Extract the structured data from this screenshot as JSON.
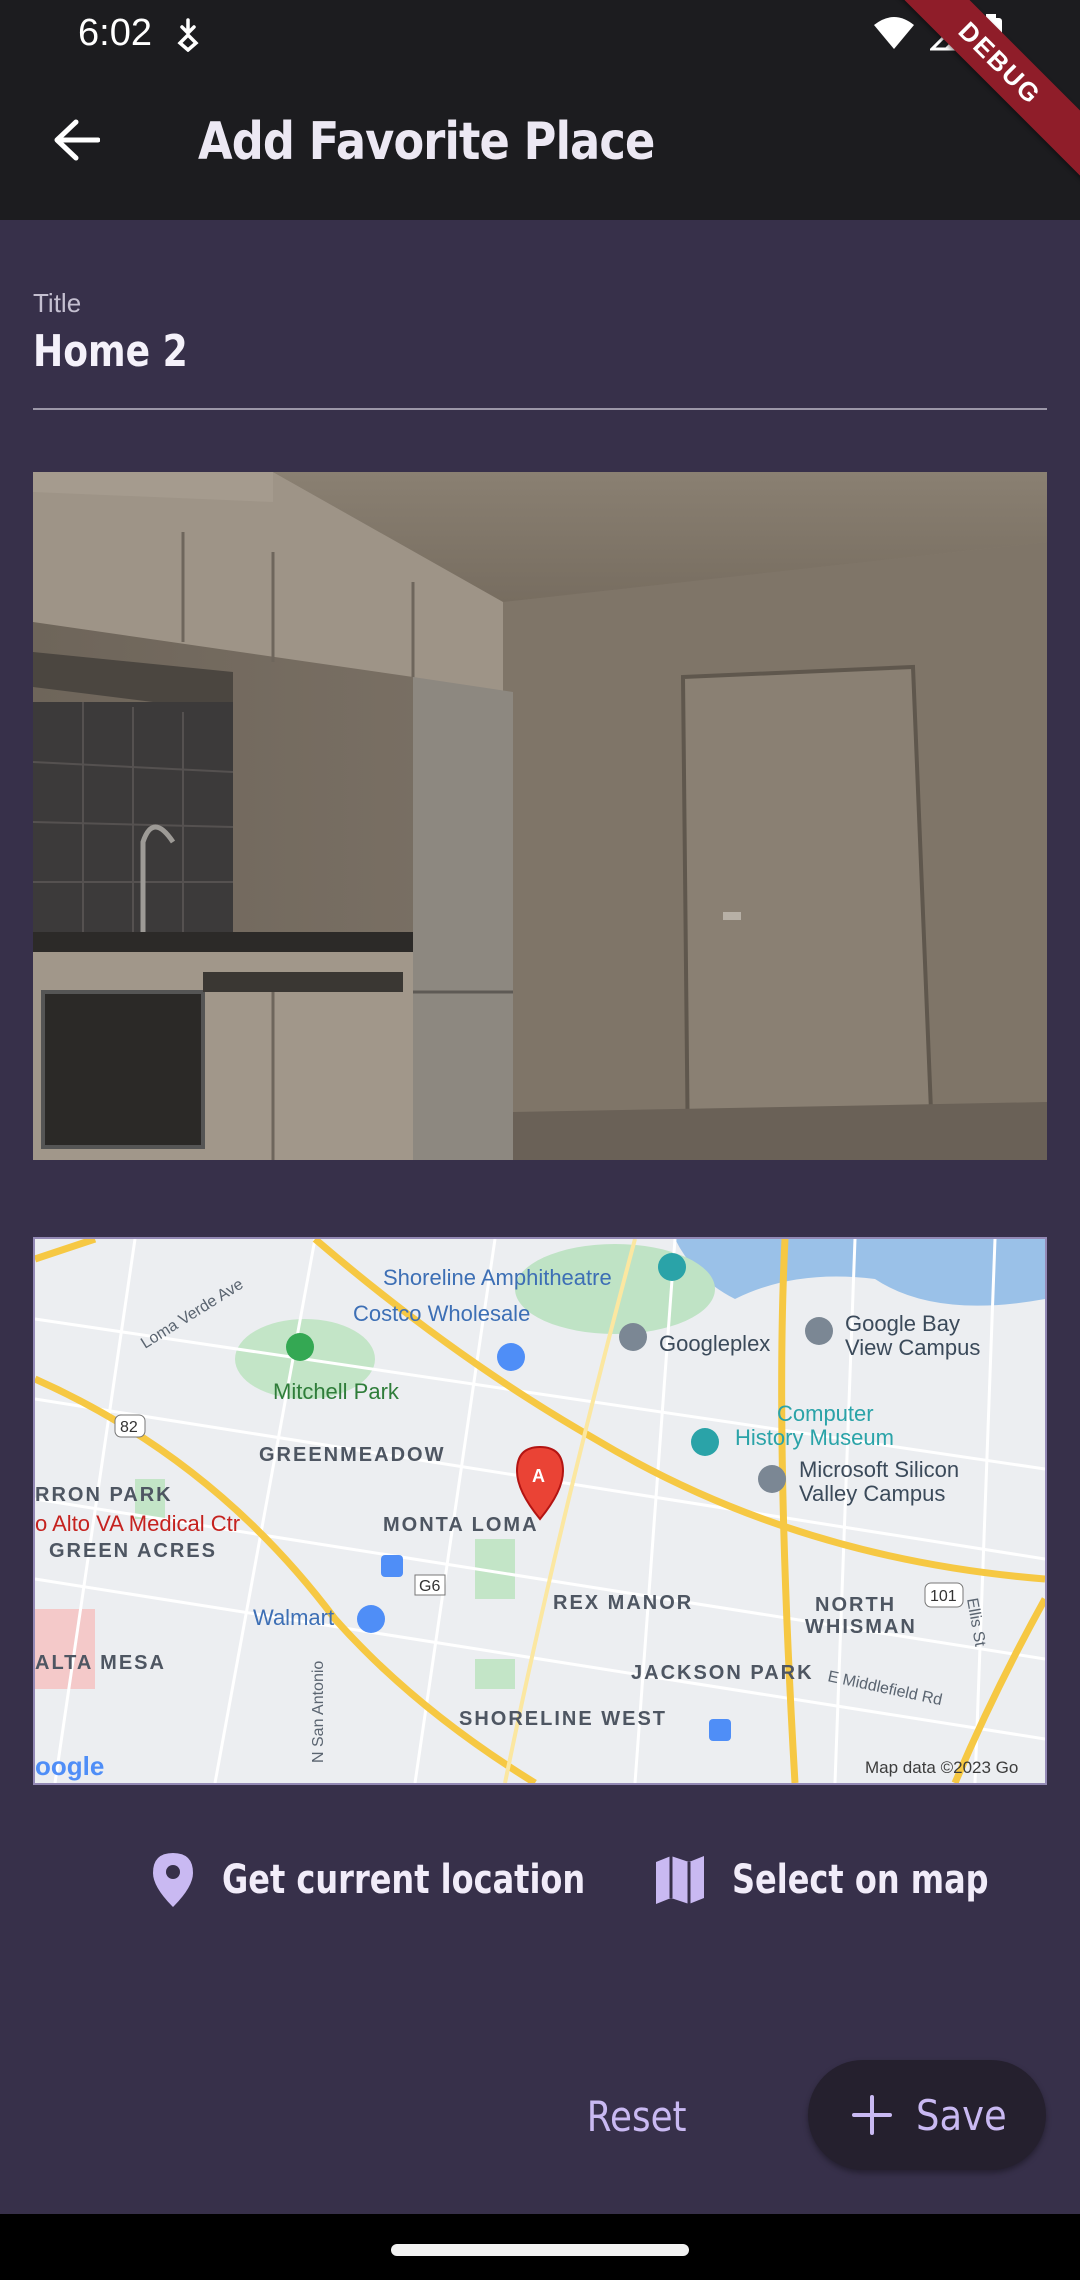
{
  "status_bar": {
    "time": "6:02",
    "icons": [
      "download-status-icon",
      "wifi-icon",
      "signal-icon",
      "battery-icon"
    ]
  },
  "debug_banner": "DEBUG",
  "app_bar": {
    "title": "Add Favorite Place",
    "back_icon": "arrow-back-icon"
  },
  "form": {
    "title_label": "Title",
    "title_value": "Home 2"
  },
  "photo": {
    "description_icon": "kitchen-photo"
  },
  "map": {
    "marker_label": "A",
    "labels": {
      "shoreline_amphitheatre": "Shoreline Amphitheatre",
      "costco": "Costco Wholesale",
      "googleplex": "Googleplex",
      "google_bay_view_1": "Google Bay",
      "google_bay_view_2": "View Campus",
      "mitchell_park": "Mitchell Park",
      "greenmeadow": "GREENMEADOW",
      "computer_history_1": "Computer",
      "computer_history_2": "History Museum",
      "microsoft_1": "Microsoft Silicon",
      "microsoft_2": "Valley Campus",
      "rron_park": "RRON PARK",
      "va_medical": "o Alto VA Medical Ctr",
      "monta_loma": "MONTA LOMA",
      "green_acres": "GREEN ACRES",
      "walmart": "Walmart",
      "rex_manor": "REX MANOR",
      "north_whisman_1": "NORTH",
      "north_whisman_2": "WHISMAN",
      "alta_mesa": "ALTA MESA",
      "jackson_park": "JACKSON PARK",
      "shoreline_west": "SHORELINE WEST",
      "loma_verde": "Loma Verde Ave",
      "n_san_antonio": "N San Antonio",
      "e_middlefield": "E Middlefield Rd",
      "ellis": "Ellis St",
      "route_82": "82",
      "route_101": "101",
      "route_g6": "G6",
      "google_logo": "oogle",
      "map_data": "Map data ©2023 Go"
    }
  },
  "actions": {
    "current_location": "Get current location",
    "select_on_map": "Select on map",
    "reset": "Reset",
    "save": "Save"
  },
  "colors": {
    "background": "#37304a",
    "app_bar": "#1c1c1f",
    "accent": "#c9b9f2",
    "debug": "#8f1d29"
  }
}
